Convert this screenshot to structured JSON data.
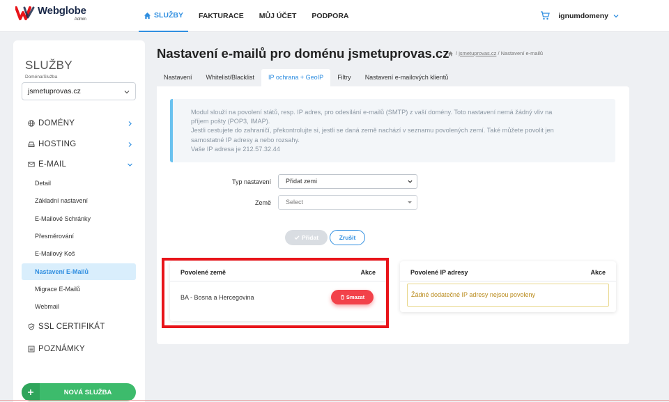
{
  "brand": {
    "name": "Webglobe",
    "sub": "Admin"
  },
  "topnav": [
    {
      "label": "SLUŽBY",
      "active": true
    },
    {
      "label": "FAKTURACE",
      "active": false
    },
    {
      "label": "MŮJ ÚČET",
      "active": false
    },
    {
      "label": "PODPORA",
      "active": false
    }
  ],
  "user": {
    "name": "ignumdomeny"
  },
  "sidebar": {
    "title": "SLUŽBY",
    "domain_label": "Doména/Služba",
    "domain_value": "jsmetuprovas.cz",
    "sections": {
      "domains": "DOMÉNY",
      "hosting": "HOSTING",
      "email": "E-MAIL",
      "ssl": "SSL CERTIFIKÁT",
      "notes": "POZNÁMKY"
    },
    "email_items": [
      "Detail",
      "Základní nastavení",
      "E-Mailové Schránky",
      "Přesměrování",
      "E-Mailový Koš",
      "Nastavení E-Mailů",
      "Migrace E-Mailů",
      "Webmail"
    ],
    "new_service": "NOVÁ SLUŽBA"
  },
  "page": {
    "title": "Nastavení e-mailů pro doménu jsmetuprovas.cz",
    "breadcrumb": {
      "sep": "/",
      "link": "jsmetuprovas.cz",
      "current": "/ Nastavení e-mailů"
    }
  },
  "tabs": [
    "Nastavení",
    "Whitelist/Blacklist",
    "IP ochrana + GeoIP",
    "Filtry",
    "Nastavení e-mailových klientů"
  ],
  "info": {
    "line1": "Modul slouží na povolení států, resp. IP adres, pro odesílání e-mailů (SMTP) z vaší domény. Toto nastavení nemá žádný vliv na",
    "line2": "příjem pošty (POP3, IMAP).",
    "line3": "Jestli cestujete do zahraničí, překontrolujte si, jestli se daná země nachází v seznamu povolených zemí. Také můžete povolit jen",
    "line4": "samostatné IP adresy a nebo rozsahy.",
    "line5": "Vaše IP adresa je 212.57.32.44"
  },
  "form": {
    "type_label": "Typ nastavení",
    "type_value": "Přidat zemi",
    "country_label": "Země",
    "country_placeholder": "Select",
    "add_label": "Přidat",
    "cancel_label": "Zrušit"
  },
  "countries": {
    "header": "Povolené země",
    "action": "Akce",
    "rows": [
      {
        "name": "BA - Bosna a Hercegovina",
        "delete": "Smazat"
      }
    ]
  },
  "ips": {
    "header": "Povolené IP adresy",
    "action": "Akce",
    "empty": "Žádné dodatečné IP adresy nejsou povoleny"
  },
  "colors": {
    "accent": "#2f8ee0",
    "success": "#3dbb6c",
    "danger": "#f2424a",
    "highlight": "#e8141a"
  }
}
